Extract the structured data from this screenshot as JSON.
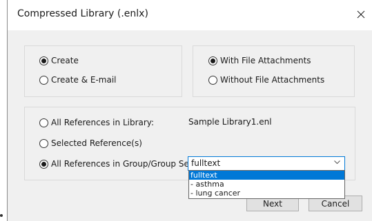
{
  "window": {
    "title": "Compressed Library (.enlx)",
    "close_icon": "close-icon"
  },
  "action_group": {
    "options": [
      {
        "label": "Create",
        "checked": true
      },
      {
        "label": "Create & E-mail",
        "checked": false
      }
    ]
  },
  "attachments_group": {
    "options": [
      {
        "label": "With File Attachments",
        "checked": true
      },
      {
        "label": "Without File Attachments",
        "checked": false
      }
    ]
  },
  "references_group": {
    "all_references_label": "All References in Library:",
    "library_name": "Sample Library1.enl",
    "selected_references_label": "Selected Reference(s)",
    "group_set_label": "All References in Group/Group Set:",
    "group_set_selected": "fulltext",
    "group_set_options": [
      "fulltext",
      "- asthma",
      "- lung cancer"
    ],
    "checked": "group_set"
  },
  "buttons": {
    "next": "Next",
    "cancel": "Cancel"
  },
  "colors": {
    "accent": "#0078d7",
    "dialog_bg": "#f0f0f0"
  }
}
